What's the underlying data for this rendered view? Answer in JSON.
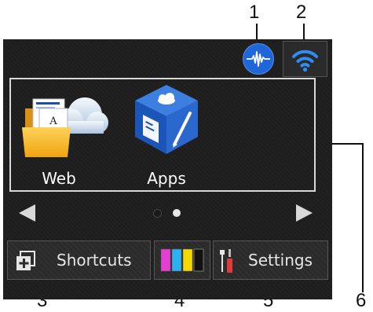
{
  "callouts": [
    "1",
    "2",
    "3",
    "4",
    "5",
    "6"
  ],
  "screen": {
    "status": {
      "ink_icon": "ink-status-icon",
      "wifi_icon": "wifi-icon"
    },
    "tiles": [
      {
        "label": "Web",
        "icon": "web-folder-icon"
      },
      {
        "label": "Apps",
        "icon": "apps-cube-icon"
      }
    ],
    "nav": {
      "left_icon": "left-arrow-icon",
      "right_icon": "right-arrow-icon",
      "dots": 2,
      "active_dot": 2
    },
    "buttons": {
      "shortcuts": {
        "label": "Shortcuts",
        "icon": "shortcuts-icon"
      },
      "ink": {
        "icon": "ink-cartridges-icon",
        "colors": [
          "#e43fd0",
          "#2cb0f0",
          "#f5d800",
          "#111111"
        ]
      },
      "settings": {
        "label": "Settings",
        "icon": "settings-tools-icon"
      }
    }
  }
}
